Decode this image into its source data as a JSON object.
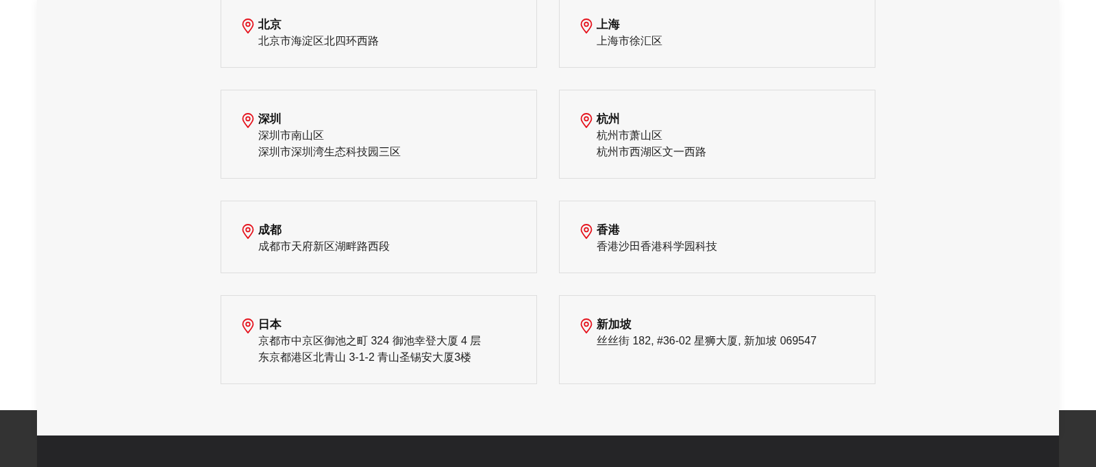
{
  "offices": [
    {
      "city": "北京",
      "addresses": [
        "北京市海淀区北四环西路"
      ]
    },
    {
      "city": "上海",
      "addresses": [
        "上海市徐汇区"
      ]
    },
    {
      "city": "深圳",
      "addresses": [
        "深圳市南山区",
        "深圳市深圳湾生态科技园三区"
      ]
    },
    {
      "city": "杭州",
      "addresses": [
        "杭州市萧山区",
        "杭州市西湖区文一西路"
      ]
    },
    {
      "city": "成都",
      "addresses": [
        "成都市天府新区湖畔路西段"
      ]
    },
    {
      "city": "香港",
      "addresses": [
        "香港沙田香港科学园科技"
      ]
    },
    {
      "city": "日本",
      "addresses": [
        "京都市中京区御池之町 324 御池幸登大厦 4 层",
        "东京都港区北青山 3-1-2 青山圣锡安大厦3楼"
      ]
    },
    {
      "city": "新加坡",
      "addresses": [
        "丝丝街 182, #36-02 星狮大厦, 新加坡 069547"
      ]
    }
  ]
}
